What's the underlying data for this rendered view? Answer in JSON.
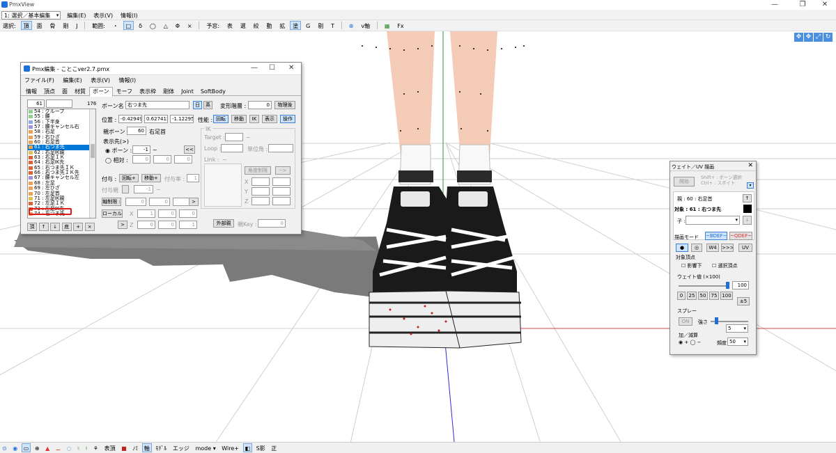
{
  "app": {
    "title": "PmxView"
  },
  "window_controls": {
    "minimize": "—",
    "maximize": "❐",
    "close": "✕"
  },
  "toolbar": {
    "mode_dropdown": "1: 選択／基本編集",
    "menus": [
      "編集(E)",
      "表示(V)",
      "情報(I)"
    ],
    "select_label": "選択:",
    "select_btns": [
      "頂",
      "面",
      "骨",
      "剛",
      "J"
    ],
    "range_label": "範囲:",
    "range_btns": [
      "・",
      "□",
      "δ",
      "◯",
      "△",
      "Φ",
      "×"
    ],
    "tool_label": "予窓:",
    "tool_btns": [
      "表",
      "選",
      "絞",
      "動",
      "拡",
      "塗",
      "G",
      "剔",
      "T"
    ],
    "vaxis": "v軸",
    "fx": "Fx"
  },
  "pmx_editor": {
    "title": "Pmx編集 - ことこver2.7.pmx",
    "menus": [
      "ファイル(F)",
      "編集(E)",
      "表示(V)",
      "情報(I)"
    ],
    "tabs": [
      "情報",
      "頂点",
      "面",
      "材質",
      "ボーン",
      "モーフ",
      "表示枠",
      "剛体",
      "Joint",
      "SoftBody"
    ],
    "active_tab": "ボーン",
    "index_value": "61",
    "count": "176",
    "bone_list": [
      {
        "label": "54 : グループ",
        "color": "#8fd18f"
      },
      {
        "label": "55 : 腰",
        "color": "#8fd18f"
      },
      {
        "label": "56 : 下半身",
        "color": "#8fa8e8"
      },
      {
        "label": "57 : 腰キャンセル右",
        "color": "#a090e0"
      },
      {
        "label": "58 : 右足",
        "color": "#f0a050"
      },
      {
        "label": "59 : 右ひざ",
        "color": "#f0a050"
      },
      {
        "label": "60 : 右足首",
        "color": "#f0a050"
      },
      {
        "label": "61 : 右つま先",
        "color": "#f0a050"
      },
      {
        "label": "62 : 右足IK親",
        "color": "#e0c050"
      },
      {
        "label": "63 : 右足ＩＫ",
        "color": "#e06030"
      },
      {
        "label": "64 : 右足IK先",
        "color": "#e06030"
      },
      {
        "label": "65 : 右つま先ＩＫ",
        "color": "#e06030"
      },
      {
        "label": "66 : 右つま先ＩＫ先",
        "color": "#e06030"
      },
      {
        "label": "67 : 腰キャンセル左",
        "color": "#a090e0"
      },
      {
        "label": "68 : 左足",
        "color": "#f0a050"
      },
      {
        "label": "69 : 左ひざ",
        "color": "#f0a050"
      },
      {
        "label": "70 : 左足首",
        "color": "#f0a050"
      },
      {
        "label": "71 : 左足IK親",
        "color": "#e0c050"
      },
      {
        "label": "72 : 左足ＩＫ",
        "color": "#e06030"
      },
      {
        "label": "73 : 左足IK先",
        "color": "#e06030"
      },
      {
        "label": "74 : 左つま先",
        "color": "#f0a050"
      }
    ],
    "selected_index": 7,
    "list_buttons": [
      "頂",
      "↑",
      "↓",
      "底",
      "+",
      "×"
    ],
    "bone_name_label": "ボーン名 :",
    "bone_name": "右つま先",
    "lang_jp": "日",
    "lang_en": "英",
    "deform_label": "変形階層 :",
    "deform_value": "0",
    "physics_after": "物理後",
    "position_label": "位置 :",
    "pos": [
      "-0.429494",
      "0.6274152",
      "-1.122951"
    ],
    "perf_label": "性能 :",
    "perf_btns": [
      "回転",
      "移動",
      "IK",
      "表示",
      "操作"
    ],
    "parent_label": "親ボーン :",
    "parent_value": "60",
    "parent_name": "右足首",
    "display_dest": "表示先(>)",
    "radio_bone": "ボーン :",
    "bone_dest": "-1",
    "radio_relative": "相対 :",
    "rel": [
      "0",
      "0",
      "0"
    ],
    "dbl_arrow": "<<",
    "grant_label": "付与 :",
    "grant_rot": "回転+",
    "grant_move": "移動+",
    "grant_rate_label": "付与率 :",
    "grant_rate": "1",
    "grant_parent_label": "付与親",
    "grant_parent": "-1",
    "axis_limit": "軸制限 :",
    "axis_vals": [
      "0",
      "0",
      "0"
    ],
    "local_axis": "ローカル軸",
    "local_x": [
      "1",
      "0",
      "0"
    ],
    "local_z": [
      "0",
      "0",
      "1"
    ],
    "ik_label": "IK",
    "ik_target": "Target :",
    "ik_loop": "Loop :",
    "ik_unit": "単位角 :",
    "ik_link": "Link :",
    "angle_limit": "角度制限",
    "ext_parent": "外部親",
    "parent_key_label": "親Key :",
    "parent_key": "0",
    "arrow_btn": ">",
    "dash": "~"
  },
  "weight_panel": {
    "title": "ウェイト／UV 描画",
    "start": "開始",
    "shift_hint1": "Shift+ : ボーン選択",
    "shift_hint2": "Ctrl+ : スポイト",
    "parent_label": "親 :",
    "parent_value": "60 : 右足首",
    "target_label": "対象 :",
    "target_value": "61 : 右つま先",
    "child_label": "子 :",
    "draw_mode": "描画モード",
    "bdef": "~BDEF~",
    "qdef": "~QDEF~",
    "mode_btns": [
      "●",
      "◎",
      "W4",
      ">>>",
      "UV"
    ],
    "target_verts": "対象頂点",
    "chk_influence": "影響下",
    "chk_selected": "選択頂点",
    "weight_label": "ウェイト値 (×100)",
    "weight_value": "100",
    "presets": [
      "0",
      "25",
      "50",
      "75",
      "100"
    ],
    "plusminus": "±5",
    "spray": "スプレー",
    "on": "ON",
    "strength": "強さ",
    "strength_value": "5",
    "add_sub": "加／減算",
    "plus": "+",
    "minus": "−",
    "freq_label": "頻度",
    "freq_value": "50"
  },
  "statusbar": {
    "items": [
      "表頂",
      "ﾉﾐ",
      "軸",
      "ﾓﾃﾞﾙ",
      "エッジ",
      "mode ▾",
      "Wire+",
      "S影",
      "正"
    ]
  }
}
